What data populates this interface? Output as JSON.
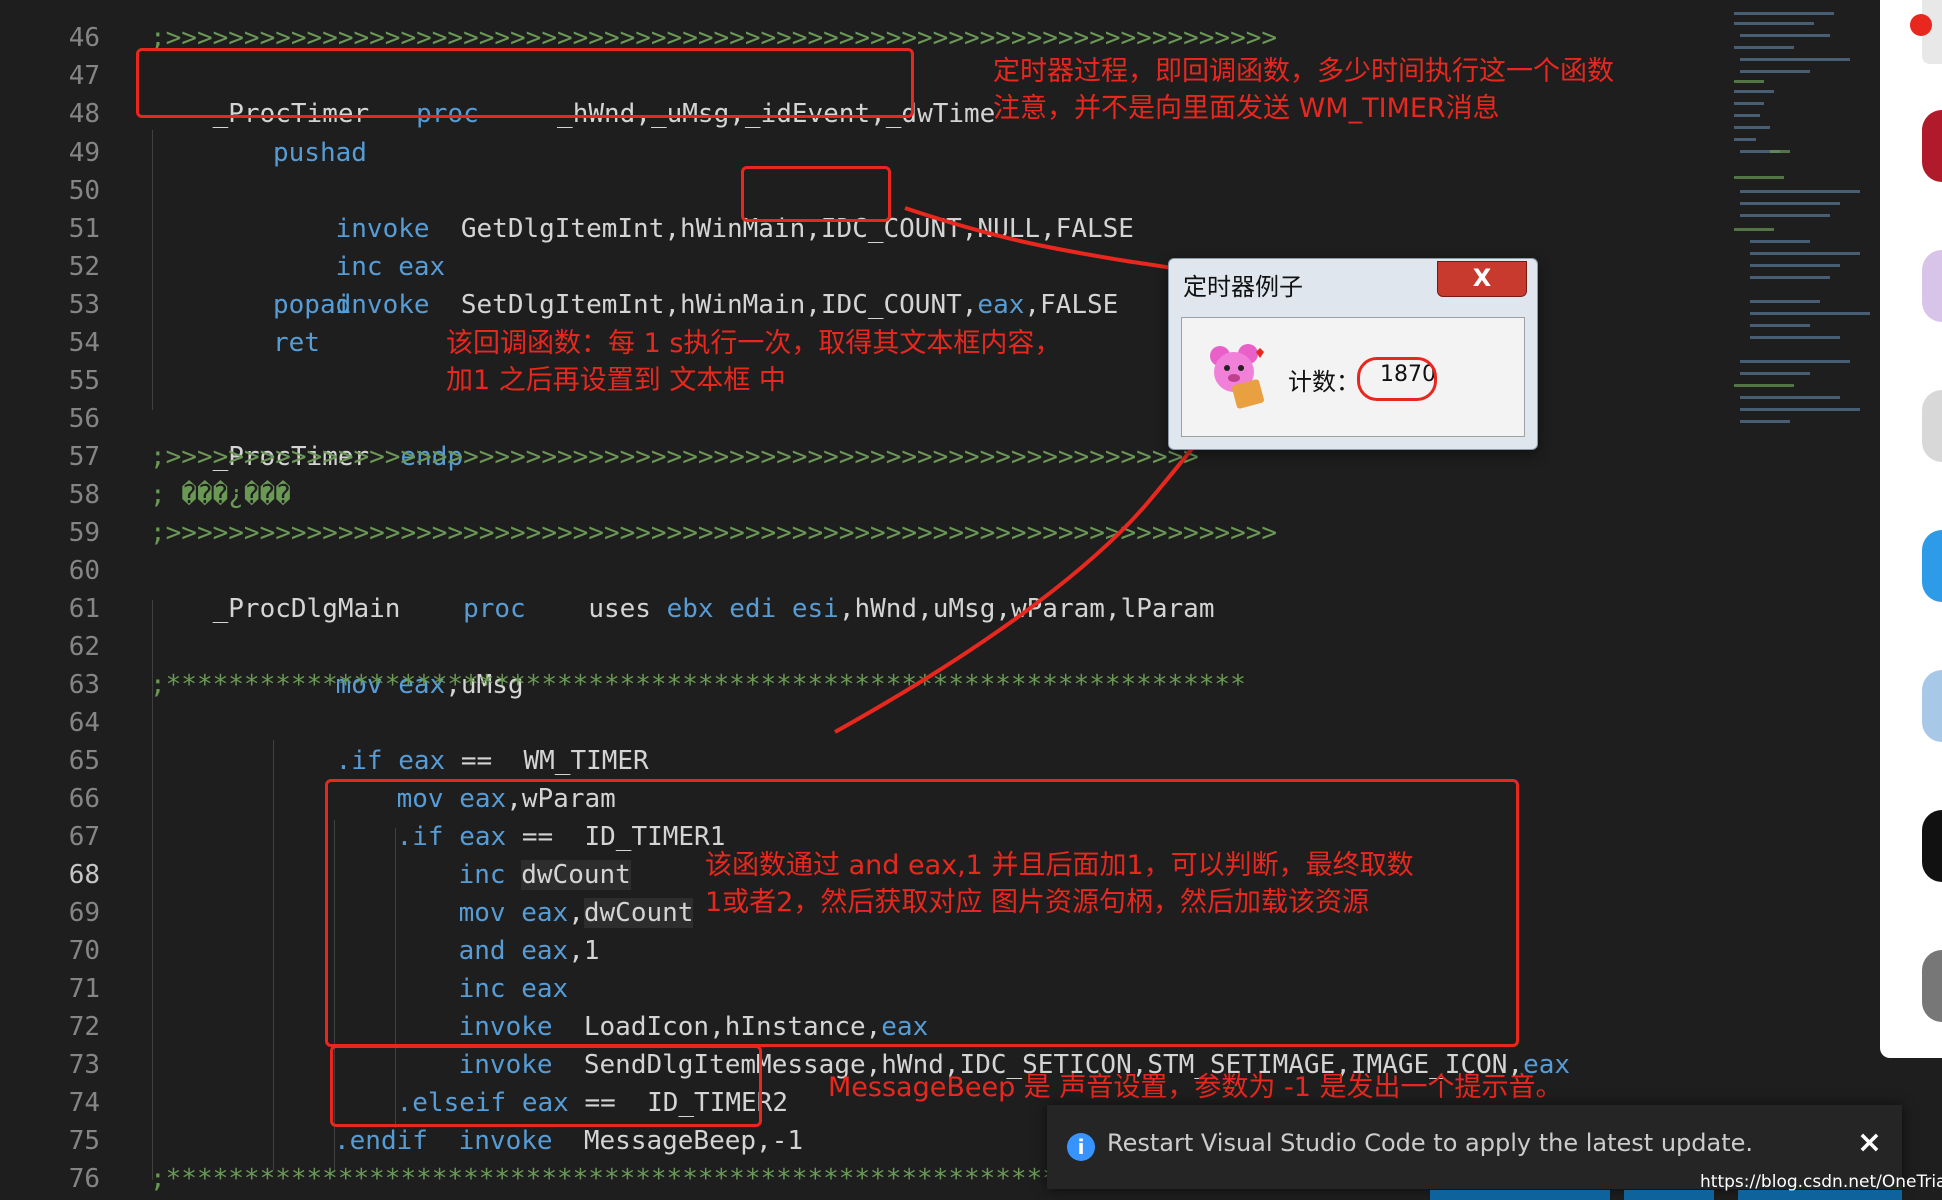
{
  "editor": {
    "line_numbers": [
      "46",
      "47",
      "48",
      "49",
      "50",
      "51",
      "52",
      "53",
      "54",
      "55",
      "56",
      "57",
      "58",
      "59",
      "60",
      "61",
      "62",
      "63",
      "64",
      "65",
      "66",
      "67",
      "68",
      "69",
      "70",
      "71",
      "72",
      "73",
      "74",
      "75",
      "76"
    ],
    "active_line": "68",
    "lines": {
      "l46": ";>>>>>>>>>>>>>>>>>>>>>>>>>>>>>>>>>>>>>>>>>>>>>>>>>>>>>>>>>>>>>>>>>>>>>>>",
      "l47a": "_ProcTimer",
      "l47b": "proc",
      "l47c": "_hWnd,_uMsg,_idEvent,_dwTime",
      "l49": "pushad",
      "l50a": "invoke",
      "l50b": "GetDlgItemInt,hWinMain,IDC_COUNT,NULL,FALSE",
      "l51a": "inc",
      "l51b": "eax",
      "l52a": "invoke",
      "l52b": "SetDlgItemInt,hWinMain,IDC_COUNT,",
      "l52c": "eax",
      "l52d": ",FALSE",
      "l53": "popad",
      "l54": "ret",
      "l56a": "_ProcTimer",
      "l56b": "endp",
      "l57": ";>>>>>>>>>>>>>>>>>>>>>>>>>>>>>>>>>>>>>>>>>>>>>>>>>>>>>>>>>>>>>>>>>>",
      "l58": "; ���¿���",
      "l59": ";>>>>>>>>>>>>>>>>>>>>>>>>>>>>>>>>>>>>>>>>>>>>>>>>>>>>>>>>>>>>>>>>>>>>>>>",
      "l60a": "_ProcDlgMain",
      "l60b": "proc",
      "l60c": "uses",
      "l60d": "ebx edi esi",
      "l60e": ",hWnd,uMsg,wParam,lParam",
      "l62a": "mov",
      "l62b": "eax",
      "l62c": ",uMsg",
      "l63": ";*********************************************************************",
      "l64a": ".if",
      "l64b": "eax",
      "l64c": "==  WM_TIMER",
      "l65a": "mov",
      "l65b": "eax",
      "l65c": ",wParam",
      "l66a": ".if",
      "l66b": "eax",
      "l66c": "==  ID_TIMER1",
      "l67a": "inc",
      "l67b": "dwCount",
      "l68a": "mov",
      "l68b": "eax",
      "l68c": ",",
      "l68d": "dwCount",
      "l69a": "and",
      "l69b": "eax",
      "l69c": ",1",
      "l70a": "inc",
      "l70b": "eax",
      "l71a": "invoke",
      "l71b": "LoadIcon,hInstance,",
      "l71c": "eax",
      "l72a": "invoke",
      "l72b": "SendDlgItemMessage,hWnd,IDC_SETICON,STM_SETIMAGE,IMAGE_ICON,",
      "l72c": "eax",
      "l73a": ".elseif",
      "l73b": "eax",
      "l73c": "==  ID_TIMER2",
      "l74a": "invoke",
      "l74b": "MessageBeep,-1",
      "l75": ".endif",
      "l76": ";*************************************************************"
    }
  },
  "annotations": {
    "a1": "定时器过程，即回调函数，多少时间执行这一个函数\n注意，并不是向里面发送 WM_TIMER消息",
    "a2": "该回调函数：每 1 s执行一次，取得其文本框内容，\n加1 之后再设置到 文本框 中",
    "a3": "该函数通过 and eax,1 并且后面加1，可以判断，最终取数\n1或者2，然后获取对应 图片资源句柄，然后加载该资源",
    "a4": "MessageBeep 是 声音设置，参数为 -1 是发出一个提示音。"
  },
  "dialog": {
    "title": "定时器例子",
    "close": "X",
    "count_label": "计数：",
    "count_value": "1870",
    "icon": "bear-icon"
  },
  "notification": {
    "icon": "info-icon",
    "text": "Restart Visual Studio Code to apply the latest update.",
    "close": "×"
  },
  "watermark": "https://blog.csdn.net/OneTrianee",
  "colors": {
    "background": "#1e1e1e",
    "keyword": "#569cd6",
    "comment": "#6a9955",
    "annotation": "#e8281e"
  }
}
